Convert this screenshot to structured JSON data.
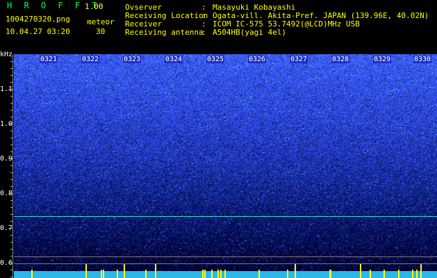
{
  "header": {
    "app_name": "H R O F F T",
    "version": "1.00",
    "filename": "1004270320.png",
    "timestamp": "10.04.27 03:20",
    "meteor_label": "meteor",
    "meteor_count": "30"
  },
  "info": [
    {
      "label": "Ovserver",
      "value": "Masayuki Kobayashi"
    },
    {
      "label": "Receiving Location",
      "value": "Ogata-vill. Akita-Pref. JAPAN (139.96E, 40.02N)"
    },
    {
      "label": "Receiver",
      "value": "ICOM IC-575 53.7492(@LCD)MHz USB"
    },
    {
      "label": "Receiving antenna",
      "value": "A504HB(yagi 4el)"
    }
  ],
  "info_separator": ":",
  "axis": {
    "y_unit": "kHz",
    "y_ticks": [
      "1.1",
      "1.0",
      "0.9",
      "0.8",
      "0.7",
      "0.6"
    ],
    "x_ticks": [
      "0321",
      "0322",
      "0323",
      "0324",
      "0325",
      "0326",
      "0327",
      "0328",
      "0329",
      "0330"
    ]
  },
  "colors": {
    "background": "#000000",
    "label_yellow": "#ffff00",
    "noise_high": "#3c5cff",
    "noise_low": "#010233",
    "carrier_line": "#2ae0c0",
    "bottom_band": "#2ab8e8"
  }
}
